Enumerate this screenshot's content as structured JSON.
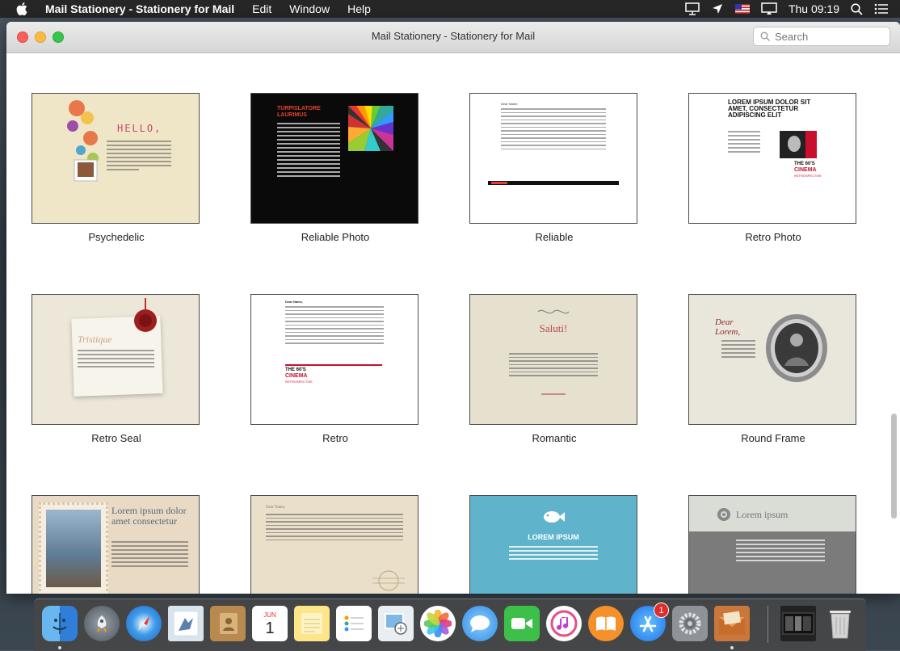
{
  "menubar": {
    "app_name": "Mail Stationery - Stationery for Mail",
    "menus": [
      "Edit",
      "Window",
      "Help"
    ],
    "clock": "Thu 09:19"
  },
  "window": {
    "title": "Mail Stationery - Stationery for Mail",
    "search_placeholder": "Search"
  },
  "templates": [
    {
      "name": "Psychedelic",
      "thumb": {
        "heading": "HELLO,"
      }
    },
    {
      "name": "Reliable Photo",
      "thumb": {
        "heading": "TURPISLATORE LAURIMUS"
      }
    },
    {
      "name": "Reliable",
      "thumb": {
        "heading": "Dear Name,"
      }
    },
    {
      "name": "Retro Photo",
      "thumb": {
        "heading": "LOREM IPSUM DOLOR SIT AMET, CONSECTETUR ADIPISCING ELIT",
        "sub": "THE 60'S",
        "sub2": "CINEMA",
        "sub3": "RETROSPECTIVE"
      }
    },
    {
      "name": "Retro Seal",
      "thumb": {
        "heading": "Tristique"
      }
    },
    {
      "name": "Retro",
      "thumb": {
        "heading": "Dear Name,",
        "sub": "THE 60'S",
        "sub2": "CINEMA",
        "sub3": "RETROSPECTIVE"
      }
    },
    {
      "name": "Romantic",
      "thumb": {
        "heading": "Saluti!"
      }
    },
    {
      "name": "Round Frame",
      "thumb": {
        "heading": "Dear Lorem,"
      }
    },
    {
      "name": "",
      "thumb": {
        "heading": "Lorem ipsum dolor amet consectetur"
      }
    },
    {
      "name": "",
      "thumb": {
        "heading": "Dear Name,"
      }
    },
    {
      "name": "",
      "thumb": {
        "heading": "LOREM IPSUM"
      }
    },
    {
      "name": "",
      "thumb": {
        "heading": "Lorem ipsum"
      }
    }
  ],
  "dock": {
    "calendar_month": "JUN",
    "calendar_day": "1",
    "appstore_badge": "1",
    "icons": [
      "finder-icon",
      "launchpad-icon",
      "safari-icon",
      "mail-icon",
      "contacts-icon",
      "calendar-icon",
      "notes-icon",
      "reminders-icon",
      "preview-icon",
      "photos-icon",
      "messages-icon",
      "facetime-icon",
      "itunes-icon",
      "ibooks-icon",
      "app-store-icon",
      "system-preferences-icon",
      "mail-stationery-icon",
      "downloads-stack-icon",
      "trash-icon"
    ]
  },
  "colors": {
    "menubar": "#262626",
    "retro_red": "#c8102e",
    "romantic_red": "#b7473f",
    "teal": "#5fb4cc"
  }
}
